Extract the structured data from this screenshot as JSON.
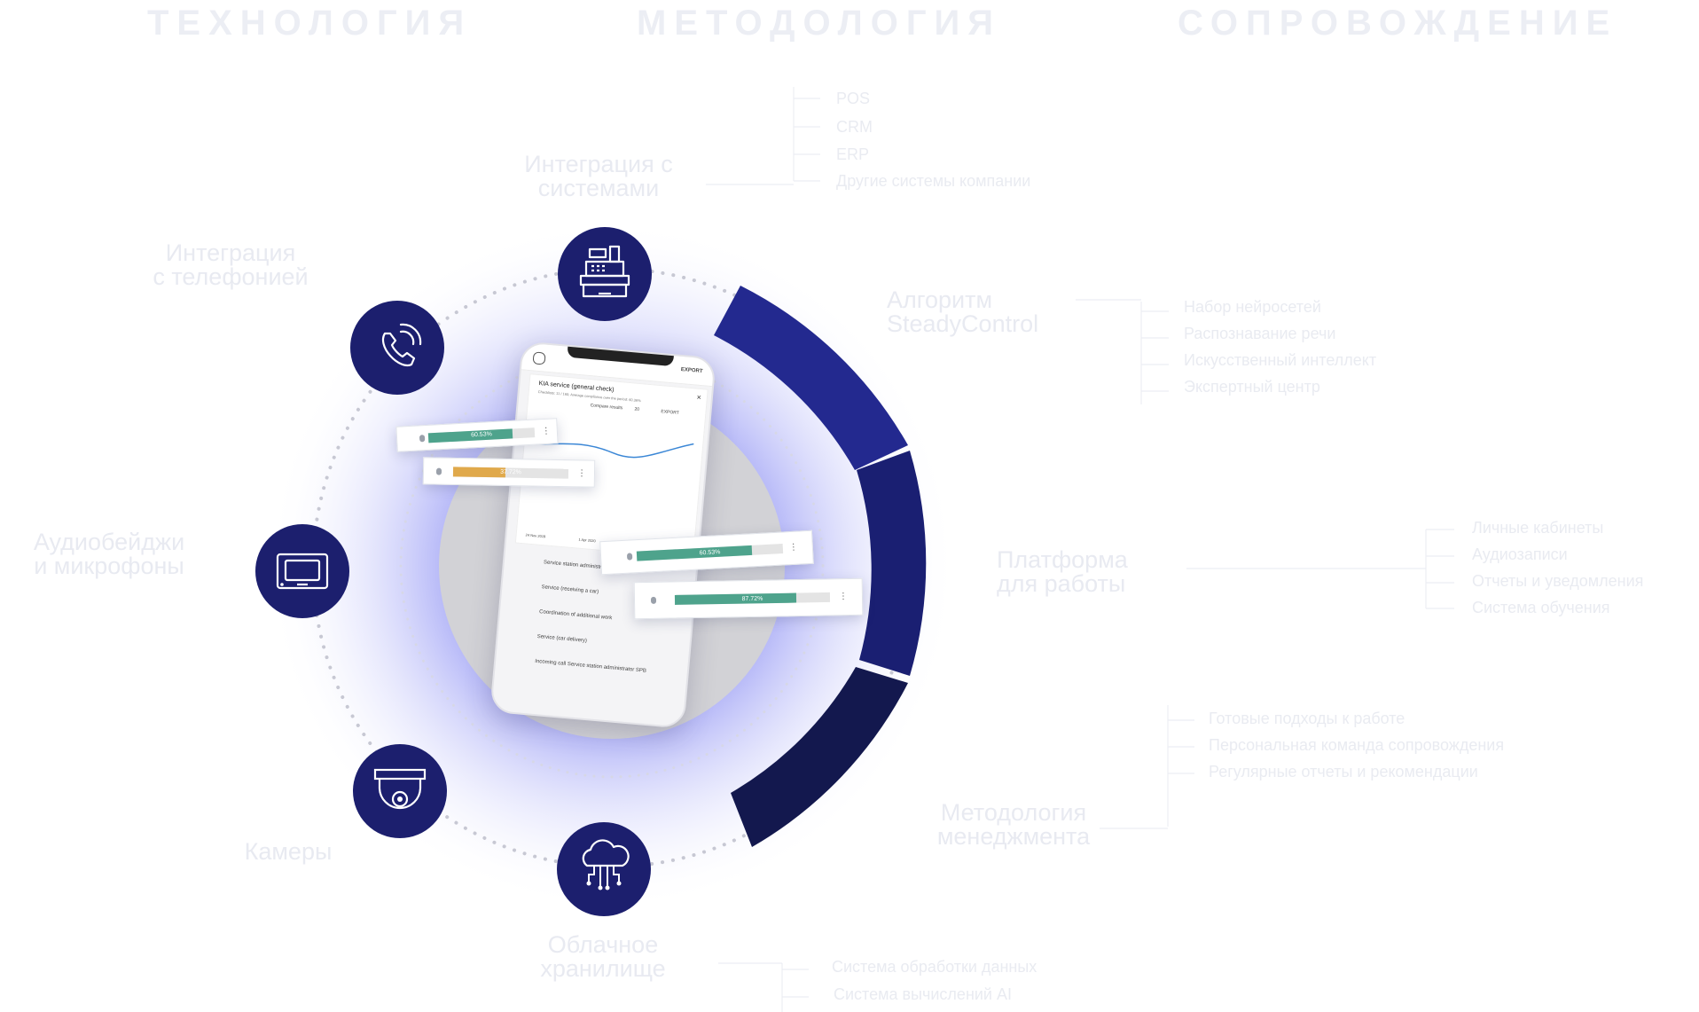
{
  "headers": {
    "technology": "ТЕХНОЛОГИЯ",
    "methodology": "МЕТОДОЛОГИЯ",
    "support": "СОПРОВОЖДЕНИЕ"
  },
  "nodes": {
    "systems_integration": {
      "label": "Интеграция с\nсистемами",
      "icon": "cash-register-icon",
      "items": [
        "POS",
        "CRM",
        "ERP",
        "Другие системы компании"
      ]
    },
    "telephony": {
      "label": "Интеграция\nс телефонией",
      "icon": "phone-icon"
    },
    "audio_badges": {
      "label": "Аудиобейджи\nи микрофоны",
      "icon": "audio-badge-icon"
    },
    "cameras": {
      "label": "Камеры",
      "icon": "dome-camera-icon"
    },
    "cloud_storage": {
      "label": "Облачное\nхранилище",
      "icon": "cloud-network-icon",
      "items": [
        "Система обработки данных",
        "Система вычислений AI"
      ]
    }
  },
  "segments": {
    "algorithm": {
      "label": "Алгоритм\nSteadyControl",
      "items": [
        "Набор нейросетей",
        "Распознавание речи",
        "Искусственный интеллект",
        "Экспертный центр"
      ]
    },
    "platform": {
      "label": "Платформа\nдля работы",
      "items": [
        "Личные кабинеты",
        "Аудиозаписи",
        "Отчеты и уведомления",
        "Система обучения"
      ]
    },
    "management": {
      "label": "Методология\nменеджмента",
      "items": [
        "Готовые подходы к работе",
        "Персональная команда сопровождения",
        "Регулярные отчеты и рекомендации"
      ]
    }
  },
  "phone": {
    "export_label": "EXPORT",
    "card_title": "KIA service (general check)",
    "card_sub": "Checklists: 11 / 160; Average compliance over the period: 60.36%",
    "compare_label": "Compare results",
    "compare_value": "20",
    "date_labels": [
      "24 Nov 2019",
      "1 Apr 2020",
      "21 Apr"
    ],
    "list_items": [
      "Service station administrator",
      "Service (receiving a car)",
      "Coordination of additional work",
      "Service (car delivery)",
      "Incoming call Service station administrator SPB"
    ]
  },
  "chips": [
    {
      "value": "60.53%",
      "fraction": 0.79,
      "color": "#4ea38c"
    },
    {
      "value": "37.72%",
      "fraction": 0.45,
      "color": "#e0a94b"
    },
    {
      "value": "60.53%",
      "fraction": 0.79,
      "color": "#4ea38c"
    },
    {
      "value": "87.72%",
      "fraction": 0.78,
      "color": "#4ea38c"
    }
  ],
  "colors": {
    "icon_circle": "#1c1f6e",
    "segment_top": "#23298f",
    "segment_mid": "#1a1f72",
    "segment_bottom": "#13184e",
    "glow": "#8c8ff2"
  }
}
